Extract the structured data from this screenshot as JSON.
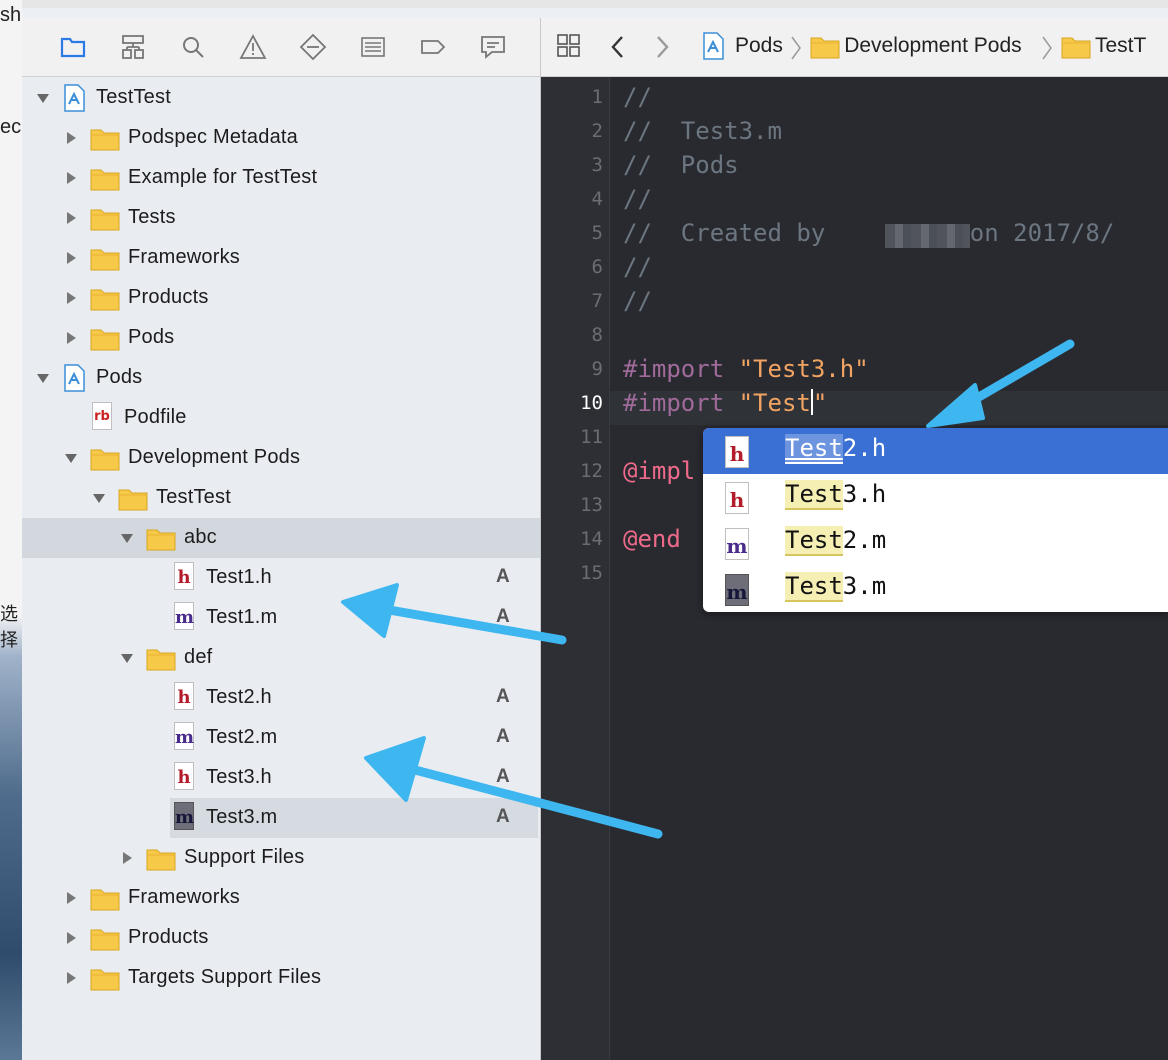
{
  "desktop": {
    "fragments": [
      "sh",
      "ec",
      "选择"
    ]
  },
  "navigator": {
    "toolbar_icons": [
      "folder-icon",
      "hierarchy-icon",
      "search-icon",
      "warning-icon",
      "test-diamond-icon",
      "debug-list-icon",
      "breakpoint-tag-icon",
      "report-bubble-icon"
    ],
    "tree": [
      {
        "label": "TestTest",
        "type": "project",
        "expanded": true,
        "level": 0
      },
      {
        "label": "Podspec Metadata",
        "type": "folder",
        "expanded": false,
        "level": 1
      },
      {
        "label": "Example for TestTest",
        "type": "folder",
        "expanded": false,
        "level": 1
      },
      {
        "label": "Tests",
        "type": "folder",
        "expanded": false,
        "level": 1
      },
      {
        "label": "Frameworks",
        "type": "folder",
        "expanded": false,
        "level": 1
      },
      {
        "label": "Products",
        "type": "folder",
        "expanded": false,
        "level": 1
      },
      {
        "label": "Pods",
        "type": "folder",
        "expanded": false,
        "level": 1
      },
      {
        "label": "Pods",
        "type": "project",
        "expanded": true,
        "level": 0
      },
      {
        "label": "Podfile",
        "type": "ruby",
        "level": 1
      },
      {
        "label": "Development Pods",
        "type": "folder",
        "expanded": true,
        "level": 1
      },
      {
        "label": "TestTest",
        "type": "folder",
        "expanded": true,
        "level": 2
      },
      {
        "label": "abc",
        "type": "folder",
        "expanded": true,
        "level": 3,
        "selected": true
      },
      {
        "label": "Test1.h",
        "type": "h",
        "level": 4,
        "badge": "A"
      },
      {
        "label": "Test1.m",
        "type": "m",
        "level": 4,
        "badge": "A"
      },
      {
        "label": "def",
        "type": "folder",
        "expanded": true,
        "level": 3
      },
      {
        "label": "Test2.h",
        "type": "h",
        "level": 4,
        "badge": "A"
      },
      {
        "label": "Test2.m",
        "type": "m",
        "level": 4,
        "badge": "A"
      },
      {
        "label": "Test3.h",
        "type": "h",
        "level": 4,
        "badge": "A"
      },
      {
        "label": "Test3.m",
        "type": "m-dark",
        "level": 4,
        "badge": "A",
        "selected": true
      },
      {
        "label": "Support Files",
        "type": "folder",
        "expanded": false,
        "level": 3
      },
      {
        "label": "Frameworks",
        "type": "folder",
        "expanded": false,
        "level": 1
      },
      {
        "label": "Products",
        "type": "folder",
        "expanded": false,
        "level": 1
      },
      {
        "label": "Targets Support Files",
        "type": "folder",
        "expanded": false,
        "level": 1
      }
    ]
  },
  "editor": {
    "breadcrumb": [
      "Pods",
      "Development Pods",
      "TestT"
    ],
    "lines": [
      {
        "n": "1",
        "segs": [
          {
            "t": "//",
            "c": ""
          }
        ]
      },
      {
        "n": "2",
        "segs": [
          {
            "t": "//  Test3.m",
            "c": ""
          }
        ]
      },
      {
        "n": "3",
        "segs": [
          {
            "t": "//  Pods",
            "c": ""
          }
        ]
      },
      {
        "n": "4",
        "segs": [
          {
            "t": "//",
            "c": ""
          }
        ]
      },
      {
        "n": "5",
        "segs": [
          {
            "t": "//  Created by",
            "c": ""
          },
          {
            "t": "          on 2017/8/",
            "c": ""
          }
        ]
      },
      {
        "n": "6",
        "segs": [
          {
            "t": "//",
            "c": ""
          }
        ]
      },
      {
        "n": "7",
        "segs": [
          {
            "t": "//",
            "c": ""
          }
        ]
      },
      {
        "n": "8",
        "segs": []
      },
      {
        "n": "9",
        "segs": [
          {
            "t": "#import ",
            "c": "kw"
          },
          {
            "t": "\"Test3.h\"",
            "c": "str"
          }
        ]
      },
      {
        "n": "10",
        "segs": [
          {
            "t": "#import ",
            "c": "kw"
          },
          {
            "t": "\"Test",
            "c": "str"
          },
          {
            "t": "|caret|",
            "c": "caret"
          },
          {
            "t": "\"",
            "c": "str"
          }
        ]
      },
      {
        "n": "11",
        "segs": []
      },
      {
        "n": "12",
        "segs": [
          {
            "t": "@impl",
            "c": "at"
          }
        ]
      },
      {
        "n": "13",
        "segs": []
      },
      {
        "n": "14",
        "segs": [
          {
            "t": "@end",
            "c": "at"
          }
        ]
      },
      {
        "n": "15",
        "segs": []
      }
    ],
    "current_line": "10"
  },
  "completion": {
    "typed": "Test",
    "items": [
      {
        "prefix": "Test",
        "rest": "2.h",
        "kind": "h",
        "active": true
      },
      {
        "prefix": "Test",
        "rest": "3.h",
        "kind": "h",
        "active": false
      },
      {
        "prefix": "Test",
        "rest": "2.m",
        "kind": "m",
        "active": false
      },
      {
        "prefix": "Test",
        "rest": "3.m",
        "kind": "m-dark",
        "active": false
      }
    ]
  },
  "colors": {
    "accent_selection": "#3a6fd4",
    "arrow": "#3eb6f0",
    "folder": "#f7c948",
    "editor_bg": "#292a30"
  }
}
